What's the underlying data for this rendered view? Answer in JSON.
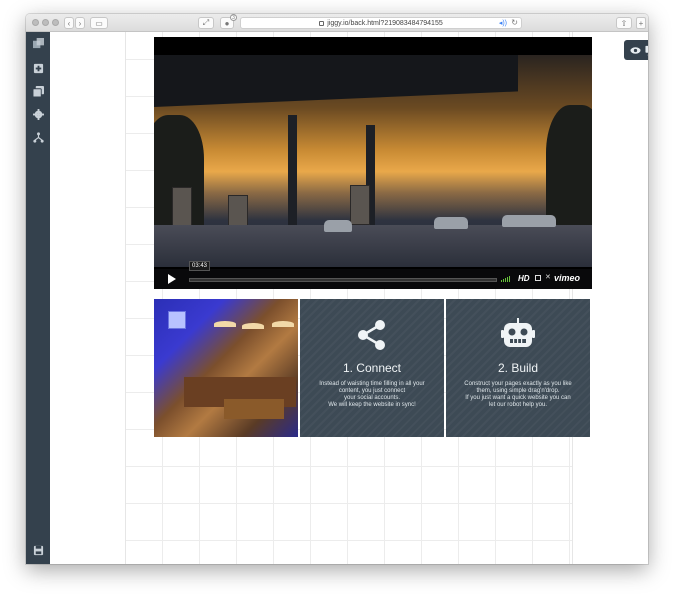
{
  "browser": {
    "url": "jiggy.io/back.html?219083484794155",
    "tab_count_badge": "3"
  },
  "video": {
    "time": "03:43",
    "hd_label": "HD",
    "brand": "vimeo"
  },
  "tiles": [
    {
      "title": "1. Connect",
      "body_lines": [
        "Instead of waisting time filling in all your",
        "content, you just connect",
        "your social accounts.",
        "We will keep the website in sync!"
      ]
    },
    {
      "title": "2. Build",
      "body_lines": [
        "Construct your pages exactly as you like",
        "them, using simple drag'n'drop.",
        "If you just want a quick website you can",
        "let our robot help you."
      ]
    }
  ],
  "colors": {
    "sidebar": "#34414d",
    "tile": "#3d4a55"
  },
  "icons": {
    "sidebar": [
      "layout-icon",
      "add-block-icon",
      "pages-icon",
      "settings-icon",
      "sitemap-icon",
      "save-icon"
    ],
    "preview": [
      "eye-icon",
      "desktop-icon"
    ],
    "tiles": [
      "share-icon",
      "robot-icon"
    ]
  }
}
